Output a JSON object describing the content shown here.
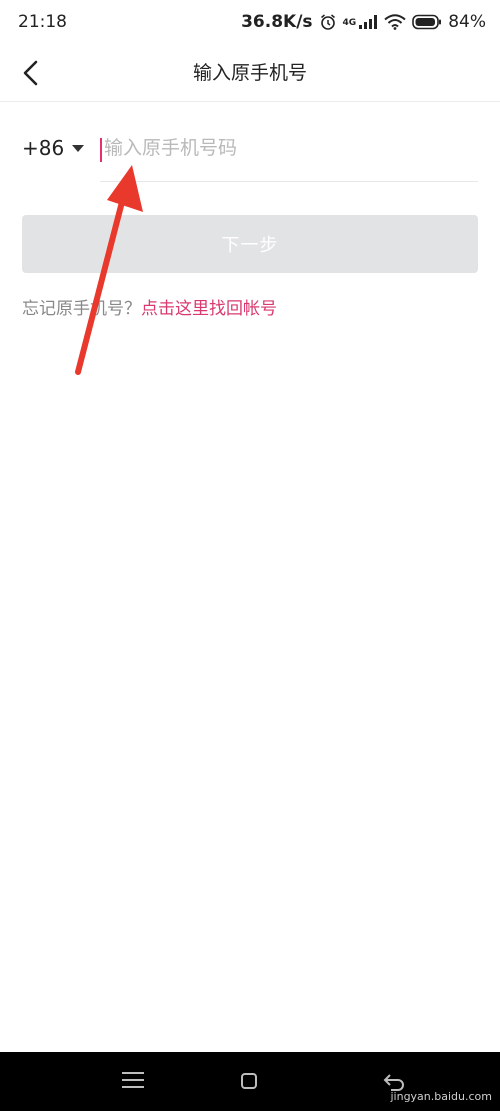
{
  "status_bar": {
    "time": "21:18",
    "net_speed": "36.8K/s",
    "network": "4G",
    "battery": "84%"
  },
  "header": {
    "title": "输入原手机号"
  },
  "phone": {
    "country_code": "+86",
    "placeholder": "输入原手机号码",
    "value": ""
  },
  "actions": {
    "next_label": "下一步"
  },
  "recovery": {
    "prompt": "忘记原手机号？",
    "link": "点击这里找回帐号"
  },
  "colors": {
    "accent": "#d9396e",
    "arrow": "#e8392c",
    "disabled_button": "#e2e3e5"
  },
  "watermark": "jingyan.baidu.com"
}
